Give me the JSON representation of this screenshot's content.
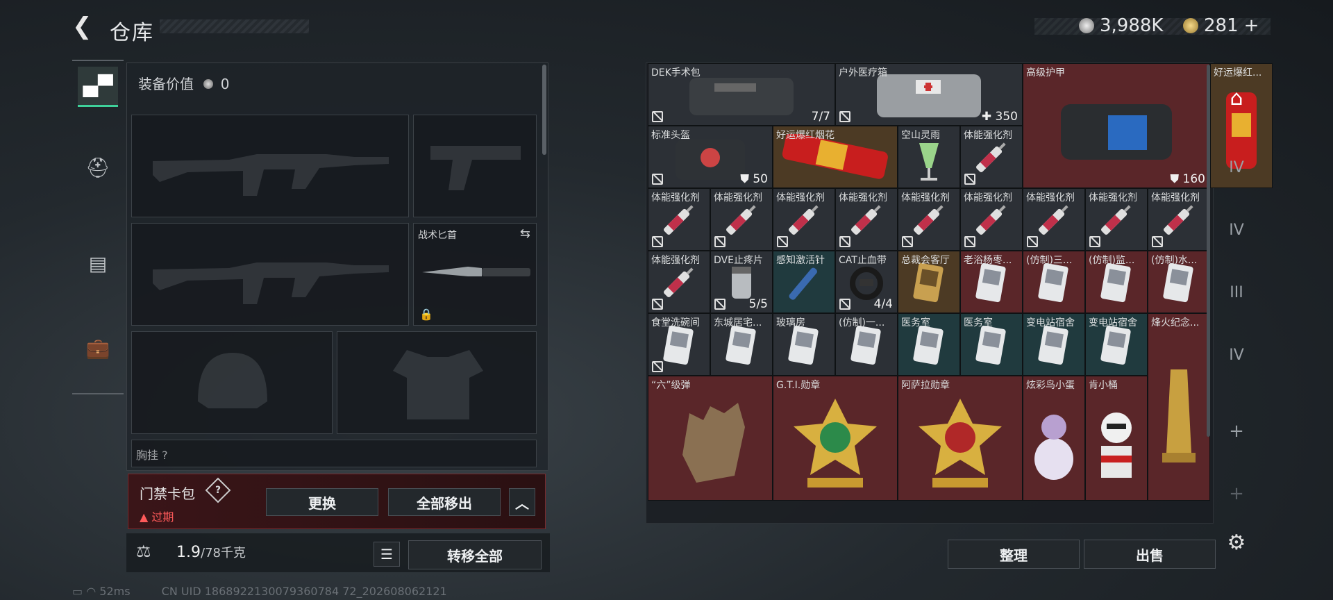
{
  "header": {
    "back_icon": "back-arrow-icon",
    "title": "仓库",
    "currency1": "3,988K",
    "currency2": "281",
    "plus": "+"
  },
  "left_tabs": [
    {
      "icon": "pistol-icon",
      "active": true
    },
    {
      "icon": "helmet-badge-icon"
    },
    {
      "icon": "vest-icon"
    },
    {
      "icon": "briefcase-icon"
    }
  ],
  "loadout": {
    "equip_value_label": "装备价值",
    "equip_value": "0",
    "knife_label": "战术匕首",
    "chest_label": "胸挂 ?"
  },
  "card_bag": {
    "title": "门禁卡包",
    "help": "?",
    "status": "过期",
    "btn_replace": "更换",
    "btn_remove_all": "全部移出"
  },
  "weight": {
    "value": "1.9",
    "max": "/78千克",
    "btn_transfer_all": "转移全部"
  },
  "inventory": {
    "items": [
      {
        "name": "DEK手术包",
        "count": "7/7",
        "bg": "dark",
        "art": "medbag",
        "nt": true
      },
      {
        "name": "户外医疗箱",
        "count": "✚ 350",
        "bg": "dark",
        "art": "medbox",
        "nt": true
      },
      {
        "name": "高级护甲",
        "count": "⛊ 160",
        "bg": "red",
        "art": "armorbag",
        "nt": false
      },
      {
        "name": "好运爆红...",
        "count": "",
        "bg": "gold",
        "art": "firecracker",
        "nt": false
      },
      {
        "name": "标准头盔",
        "count": "⛊ 50",
        "bg": "dark",
        "art": "helmetbag",
        "nt": true
      },
      {
        "name": "好运爆红烟花",
        "count": "",
        "bg": "gold",
        "art": "firework",
        "nt": false
      },
      {
        "name": "空山灵雨",
        "count": "",
        "bg": "dark",
        "art": "drink",
        "nt": false
      },
      {
        "name": "体能强化剂",
        "count": "",
        "bg": "dark",
        "art": "syringe",
        "nt": true
      },
      {
        "name": "体能强化剂",
        "count": "",
        "bg": "dark",
        "art": "syringe",
        "nt": true
      },
      {
        "name": "体能强化剂",
        "count": "",
        "bg": "dark",
        "art": "syringe",
        "nt": true
      },
      {
        "name": "体能强化剂",
        "count": "",
        "bg": "dark",
        "art": "syringe",
        "nt": true
      },
      {
        "name": "体能强化剂",
        "count": "",
        "bg": "dark",
        "art": "syringe",
        "nt": true
      },
      {
        "name": "体能强化剂",
        "count": "",
        "bg": "dark",
        "art": "syringe",
        "nt": true
      },
      {
        "name": "体能强化剂",
        "count": "",
        "bg": "dark",
        "art": "syringe",
        "nt": true
      },
      {
        "name": "体能强化剂",
        "count": "",
        "bg": "dark",
        "art": "syringe",
        "nt": true
      },
      {
        "name": "体能强化剂",
        "count": "",
        "bg": "dark",
        "art": "syringe",
        "nt": true
      },
      {
        "name": "体能强化剂",
        "count": "",
        "bg": "dark",
        "art": "syringe",
        "nt": true
      },
      {
        "name": "体能强化剂",
        "count": "",
        "bg": "dark",
        "art": "syringe",
        "nt": true
      },
      {
        "name": "DVE止疼片",
        "count": "5/5",
        "bg": "dark",
        "art": "pills",
        "nt": true
      },
      {
        "name": "感知激活针",
        "count": "",
        "bg": "teal",
        "art": "injector",
        "nt": false
      },
      {
        "name": "CAT止血带",
        "count": "4/4",
        "bg": "dark",
        "art": "tourniquet",
        "nt": true
      },
      {
        "name": "总裁会客厅",
        "count": "",
        "bg": "gold",
        "art": "keycard-gold",
        "nt": false
      },
      {
        "name": "老浴杨枣...",
        "count": "",
        "bg": "red",
        "art": "keycard",
        "nt": false
      },
      {
        "name": "(仿制)三...",
        "count": "",
        "bg": "red",
        "art": "keycard",
        "nt": false
      },
      {
        "name": "(仿制)监...",
        "count": "",
        "bg": "red",
        "art": "keycard",
        "nt": false
      },
      {
        "name": "(仿制)水...",
        "count": "",
        "bg": "red",
        "art": "keycard",
        "nt": false
      },
      {
        "name": "食堂洗碗间",
        "count": "",
        "bg": "dark",
        "art": "keycard",
        "nt": true
      },
      {
        "name": "东城居宅...",
        "count": "",
        "bg": "dark",
        "art": "keycard",
        "nt": false
      },
      {
        "name": "玻璃房",
        "count": "",
        "bg": "dark",
        "art": "keycard",
        "nt": false
      },
      {
        "name": "(仿制)一...",
        "count": "",
        "bg": "dark",
        "art": "keycard",
        "nt": false
      },
      {
        "name": "医务室",
        "count": "",
        "bg": "teal",
        "art": "keycard",
        "nt": false
      },
      {
        "name": "医务室",
        "count": "",
        "bg": "teal",
        "art": "keycard",
        "nt": false
      },
      {
        "name": "变电站宿舍",
        "count": "",
        "bg": "teal",
        "art": "keycard",
        "nt": false
      },
      {
        "name": "变电站宿舍",
        "count": "",
        "bg": "teal",
        "art": "keycard",
        "nt": false
      },
      {
        "name": "烽火纪念...",
        "count": "",
        "bg": "red",
        "art": "trophy",
        "nt": false
      },
      {
        "name": "“六”级弹",
        "count": "",
        "bg": "red",
        "art": "bullet-hand",
        "nt": false
      },
      {
        "name": "G.T.I.勋章",
        "count": "",
        "bg": "red",
        "art": "medal-green",
        "nt": false
      },
      {
        "name": "阿萨拉勋章",
        "count": "",
        "bg": "red",
        "art": "medal-red",
        "nt": false
      },
      {
        "name": "炫彩鸟小蛋",
        "count": "",
        "bg": "red",
        "art": "egg-figure",
        "nt": false
      },
      {
        "name": "肯小桶",
        "count": "",
        "bg": "red",
        "art": "bucket-figure",
        "nt": false
      }
    ],
    "btn_sort": "整理",
    "btn_sell": "出售"
  },
  "right_tabs": [
    {
      "icon": "home-storage-icon",
      "label": ""
    },
    {
      "icon": "folder-tier-icon",
      "label": "IV"
    },
    {
      "icon": "camera-tier-icon",
      "label": "IV"
    },
    {
      "icon": "rifle-tier-icon",
      "label": "III"
    },
    {
      "icon": "camera-tier-icon",
      "label": "IV"
    },
    {
      "icon": "add-icon",
      "label": "+"
    },
    {
      "icon": "add-icon",
      "label": "+"
    },
    {
      "icon": "settings-icon",
      "label": ""
    }
  ],
  "status": {
    "ping": "52ms",
    "uid": "CN UID 1868922130079360784 72_202608062121"
  },
  "colors": {
    "accent": "#3ed19a",
    "warning": "#e04848",
    "panel_red": "#5a2629"
  }
}
